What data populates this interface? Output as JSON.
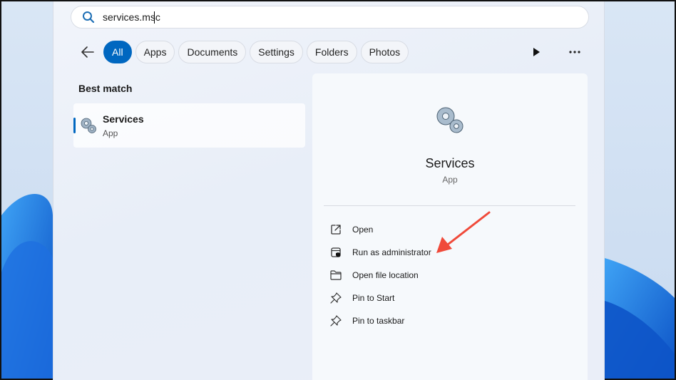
{
  "search": {
    "query": "services.msc"
  },
  "filters": {
    "items": [
      {
        "label": "All",
        "active": true
      },
      {
        "label": "Apps"
      },
      {
        "label": "Documents"
      },
      {
        "label": "Settings"
      },
      {
        "label": "Folders"
      },
      {
        "label": "Photos"
      }
    ]
  },
  "results": {
    "section_title": "Best match",
    "best_match": {
      "name": "Services",
      "type": "App",
      "icon": "gears-icon"
    }
  },
  "detail": {
    "name": "Services",
    "type": "App",
    "icon": "gears-icon",
    "actions": [
      {
        "label": "Open",
        "icon": "open-external-icon"
      },
      {
        "label": "Run as administrator",
        "icon": "shield-icon"
      },
      {
        "label": "Open file location",
        "icon": "folder-icon"
      },
      {
        "label": "Pin to Start",
        "icon": "pin-icon"
      },
      {
        "label": "Pin to taskbar",
        "icon": "pin-icon"
      }
    ]
  },
  "colors": {
    "accent": "#0067c0",
    "annotation_arrow": "#f04a3a"
  }
}
